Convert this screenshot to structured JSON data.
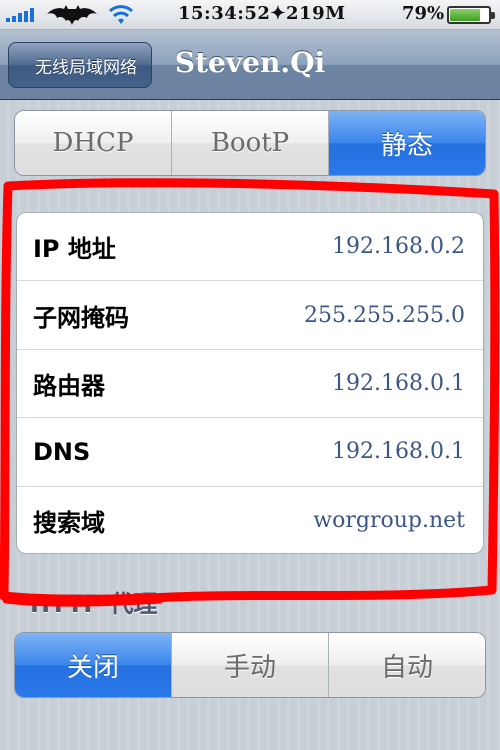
{
  "status_bar": {
    "time": "15:34:52✦219M",
    "battery_percent": "79%",
    "battery_level": 0.79
  },
  "nav": {
    "back_label": "无线局域网络",
    "title": "Steven.Qi"
  },
  "mode_tabs": {
    "items": [
      "DHCP",
      "BootP",
      "静态"
    ],
    "selected": "静态"
  },
  "settings": {
    "rows": [
      {
        "label": "IP 地址",
        "value": "192.168.0.2"
      },
      {
        "label": "子网掩码",
        "value": "255.255.255.0"
      },
      {
        "label": "路由器",
        "value": "192.168.0.1"
      },
      {
        "label": "DNS",
        "value": "192.168.0.1"
      },
      {
        "label": "搜索域",
        "value": "worgroup.net"
      }
    ]
  },
  "proxy": {
    "header": "HTTP 代理",
    "items": [
      "关闭",
      "手动",
      "自动"
    ],
    "selected": "关闭"
  },
  "colors": {
    "accent_blue": "#2a79e8",
    "value_text": "#3c5685",
    "annotation_red": "#ff0000"
  }
}
